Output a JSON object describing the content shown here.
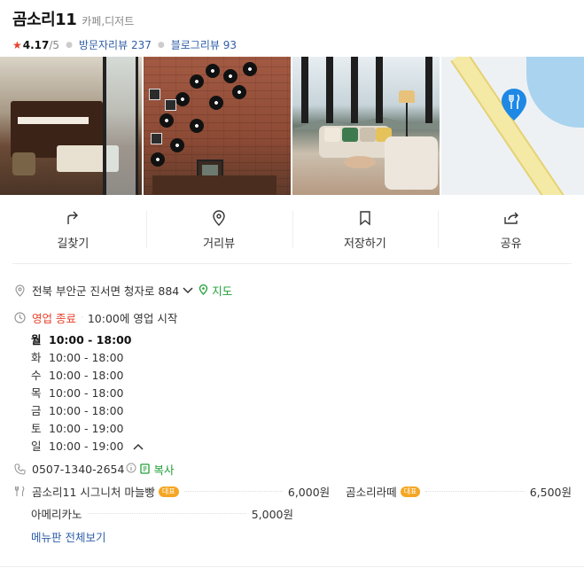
{
  "place": {
    "name": "곰소리11",
    "category": "카페,디저트",
    "rating": "4.17",
    "rating_max": "/5",
    "visitor_review_label": "방문자리뷰",
    "visitor_review_count": "237",
    "blog_review_label": "블로그리뷰",
    "blog_review_count": "93"
  },
  "actions": [
    {
      "label": "길찾기",
      "icon": "directions-icon"
    },
    {
      "label": "거리뷰",
      "icon": "location-pin-icon"
    },
    {
      "label": "저장하기",
      "icon": "bookmark-icon"
    },
    {
      "label": "공유",
      "icon": "share-icon"
    }
  ],
  "address": {
    "text": "전북 부안군 진서면 청자로 884",
    "map_label": "지도"
  },
  "status": {
    "state": "영업 종료",
    "next": "10:00에 영업 시작"
  },
  "hours": [
    {
      "day": "월",
      "time": "10:00 - 18:00",
      "today": true
    },
    {
      "day": "화",
      "time": "10:00 - 18:00"
    },
    {
      "day": "수",
      "time": "10:00 - 18:00"
    },
    {
      "day": "목",
      "time": "10:00 - 18:00"
    },
    {
      "day": "금",
      "time": "10:00 - 18:00"
    },
    {
      "day": "토",
      "time": "10:00 - 19:00"
    },
    {
      "day": "일",
      "time": "10:00 - 19:00"
    }
  ],
  "phone": {
    "number": "0507-1340-2654",
    "copy_label": "복사"
  },
  "menu": {
    "items": [
      {
        "name": "곰소리11 시그니처 마늘빵",
        "badge": "대표",
        "price": "6,000원"
      },
      {
        "name": "곰소리라떼",
        "badge": "대표",
        "price": "6,500원"
      },
      {
        "name": "아메리카노",
        "price": "5,000원"
      }
    ],
    "view_all": "메뉴판 전체보기"
  },
  "colors": {
    "accent_red": "#e8412c",
    "link_blue": "#2f5ea8",
    "green": "#21a038",
    "badge_orange": "#f5a623",
    "map_pin_blue": "#1e88e5"
  }
}
